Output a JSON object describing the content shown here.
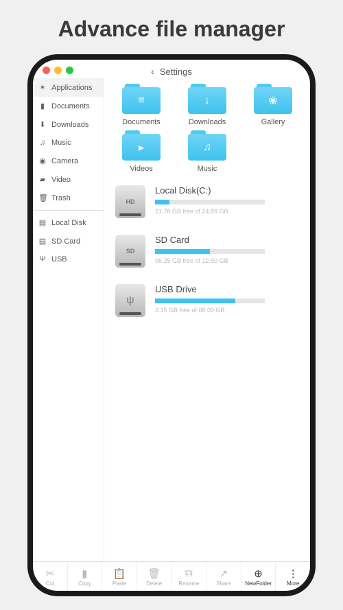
{
  "marketing_title": "Advance file manager",
  "header": {
    "back_glyph": "‹",
    "title": "Settings"
  },
  "sidebar": {
    "groups": [
      [
        {
          "icon": "✶",
          "label": "Applications",
          "active": true
        },
        {
          "icon": "▮",
          "label": "Documents"
        },
        {
          "icon": "⬇",
          "label": "Downloads"
        },
        {
          "icon": "♫",
          "label": "Music"
        },
        {
          "icon": "◉",
          "label": "Camera"
        },
        {
          "icon": "▰",
          "label": "Video"
        },
        {
          "icon": "🗑",
          "label": "Trash"
        }
      ],
      [
        {
          "icon": "▤",
          "label": "Local Disk"
        },
        {
          "icon": "▤",
          "label": "SD Card"
        },
        {
          "icon": "Ψ",
          "label": "USB"
        }
      ]
    ]
  },
  "folders": [
    {
      "label": "Documents",
      "glyph": "≡"
    },
    {
      "label": "Downloads",
      "glyph": "↓"
    },
    {
      "label": "Gallery",
      "glyph": "❀"
    },
    {
      "label": "Videos",
      "glyph": "▸"
    },
    {
      "label": "Music",
      "glyph": "♫"
    }
  ],
  "drives": [
    {
      "name": "Local Disk(C:)",
      "badge": "HD",
      "used_pct": 13,
      "free_text": "21.78 GB free of 24.89 GB"
    },
    {
      "name": "SD Card",
      "badge": "SD",
      "used_pct": 50,
      "free_text": "06.25 GB free of 12.50 GB"
    },
    {
      "name": "USB Drive",
      "badge": "usb",
      "used_pct": 73,
      "free_text": "2.15 GB free of 08.00 GB"
    }
  ],
  "toolbar": [
    {
      "icon": "✂",
      "label": "Cut"
    },
    {
      "icon": "▮",
      "label": "Copy"
    },
    {
      "icon": "📋",
      "label": "Paste"
    },
    {
      "icon": "🗑",
      "label": "Delete"
    },
    {
      "icon": "⧉",
      "label": "Rename"
    },
    {
      "icon": "↗",
      "label": "Share"
    },
    {
      "icon": "⊕",
      "label": "NewFolder",
      "dark": true
    },
    {
      "icon": "⋮",
      "label": "More",
      "dark": true
    }
  ]
}
